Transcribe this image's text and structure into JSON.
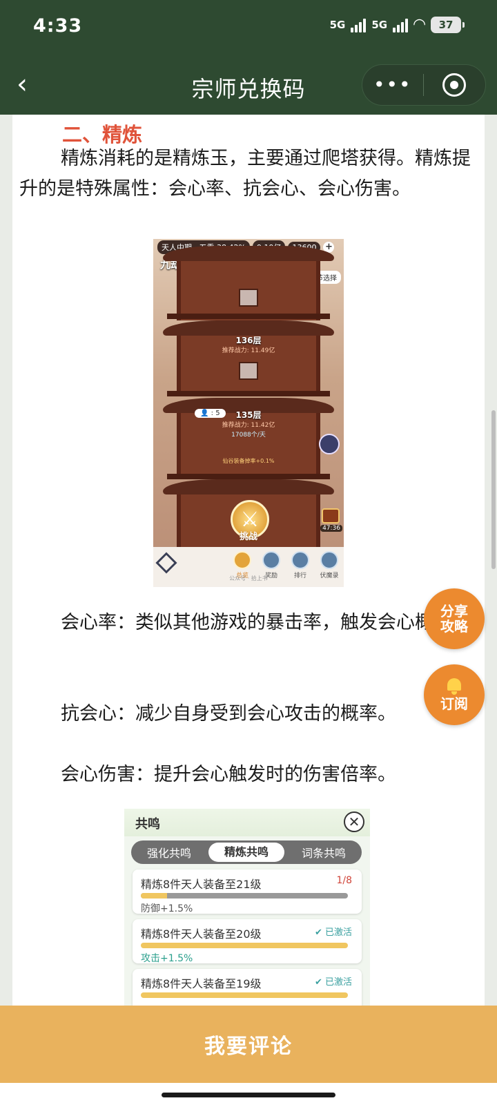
{
  "status_bar": {
    "time": "4:33",
    "network1": "5G",
    "network2": "5G",
    "battery": "37"
  },
  "nav": {
    "title": "宗师兑换码",
    "back_icon": "chevron-left-icon",
    "more_icon": "more-dots-icon",
    "target_icon": "target-icon"
  },
  "article": {
    "section_title": "二、精炼",
    "intro": "精炼消耗的是精炼玉，主要通过爬塔获得。精炼提升的是特殊属性：会心率、抗会心、会心伤害。",
    "crit_rate": "会心率：类似其他游戏的暴击率，触发会心概率。",
    "anti_crit": "抗会心：减少自身受到会心攻击的概率。",
    "crit_damage": "会心伤害：提升会心触发时的伤害倍率。"
  },
  "tower_image": {
    "player_rank": "天人中期 · 五重",
    "player_pct": "38.42%",
    "power": "9.19亿",
    "coins": "13600",
    "tower_name": "九劫仙谷[历练塔]",
    "chapter_select": "章节选择",
    "floor_136": "136层",
    "floor_136_power": "推荐战力: 11.49亿",
    "floor_135": "135层",
    "floor_135_power": "推荐战力: 11.42亿",
    "player_count": "5",
    "rate": "17088个/天",
    "bonus": "仙谷装备掉率+0.1%",
    "challenge": "挑战",
    "timer": "47:36",
    "nav_items": [
      "总览",
      "奖励",
      "排行",
      "伏魔录"
    ],
    "watermark": "公众号 · 拾上书"
  },
  "resonance_image": {
    "title": "共鸣",
    "tabs": [
      "强化共鸣",
      "精炼共鸣",
      "词条共鸣"
    ],
    "active_tab": 1,
    "cards": [
      {
        "title": "精炼8件天人装备至21级",
        "status": "1/8",
        "progress": 0.125,
        "bonus": "防御+1.5%",
        "done": false
      },
      {
        "title": "精炼8件天人装备至20级",
        "status": "已激活",
        "progress": 1.0,
        "bonus": "攻击+1.5%",
        "done": true
      },
      {
        "title": "精炼8件天人装备至19级",
        "status": "已激活",
        "progress": 1.0,
        "bonus": "",
        "done": true
      }
    ]
  },
  "floating": {
    "share_label_1": "分享",
    "share_label_2": "攻略",
    "subscribe_label": "订阅",
    "bell_icon": "bell-icon"
  },
  "footer": {
    "comment_button": "我要评论"
  },
  "colors": {
    "nav_bg": "#2e4a31",
    "section_title": "#e0533a",
    "float_btn": "#ec8a2f",
    "comment_bar": "#e9b25d"
  }
}
